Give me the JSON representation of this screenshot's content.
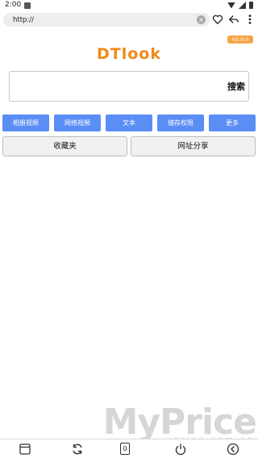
{
  "status_bar": {
    "time": "2:00"
  },
  "url_bar": {
    "value": "http://",
    "clear_glyph": "×"
  },
  "top_icons": [
    "heart-icon",
    "share-icon",
    "more-menu-icon"
  ],
  "version_badge": "V2.0.0",
  "logo_text": "DTlook",
  "search": {
    "value": "",
    "button_label": "搜索"
  },
  "category_buttons": [
    "相册视频",
    "网络视频",
    "文本",
    "储存权限",
    "更多"
  ],
  "big_buttons": [
    "收藏夹",
    "网址分享"
  ],
  "watermark": {
    "main": "MyPrice",
    "sub": "yprice.com.cn"
  },
  "bottom_nav": {
    "tab_count": "0",
    "icons": [
      "window-icon",
      "refresh-icon",
      "tab-count",
      "power-icon",
      "back-icon"
    ]
  },
  "colors": {
    "accent_orange": "#ef8a17",
    "badge_orange": "#f5a547",
    "button_blue": "#5a8ef5"
  }
}
